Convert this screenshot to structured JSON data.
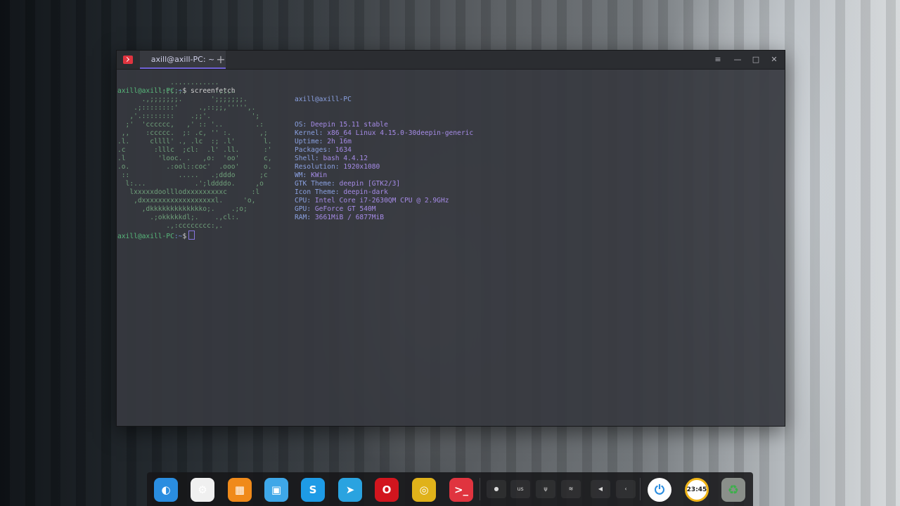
{
  "terminal": {
    "tab_label": "axill@axill-PC: ~",
    "new_tab_symbol": "+",
    "window_buttons": {
      "menu": "≡",
      "minimize": "—",
      "maximize": "□",
      "close": "✕"
    },
    "prompt": {
      "user_host": "axill@axill-PC",
      "path": ":~",
      "symbol": "$"
    },
    "command": "screenfetch",
    "ascii_art": [
      "             ............",
      "         .';;;;;.       .,;,.",
      "      .,;;;;;;;.       ';;;;;;;.",
      "    .;::::::::'     .,::;;,''''',.",
      "   ,'.::::::::    .;;'.          ';",
      "  ;'  'cccccc,   ,' :: '..        .:",
      " ,,    :ccccc.  ;: .c, '' :.       ,;",
      ".l.     cllll' ., .lc  :; .l'       l.",
      ".c       :lllc  ;cl:  .l' .ll.      :'",
      ".l        'looc. .   ,o:  'oo'      c,",
      ".o.         .:ool::coc'  .ooo'      o.",
      " ::            .....   .;dddo      ;c",
      "  l:...            .';lddddo.     ,o",
      "   lxxxxxdoolllodxxxxxxxxxc      :l",
      "    ,dxxxxxxxxxxxxxxxxxxl.     'o,",
      "      ,dkkkkkkkkkkkkko;.    .;o;",
      "        .;okkkkkdl;.    .,cl:.",
      "            .,:cccccccc:,."
    ],
    "info": {
      "host": "axill@axill-PC",
      "rows": [
        {
          "key": "OS:",
          "value": "Deepin 15.11 stable"
        },
        {
          "key": "Kernel:",
          "value": "x86_64 Linux 4.15.0-30deepin-generic"
        },
        {
          "key": "Uptime:",
          "value": "2h 16m"
        },
        {
          "key": "Packages:",
          "value": "1634"
        },
        {
          "key": "Shell:",
          "value": "bash 4.4.12"
        },
        {
          "key": "Resolution:",
          "value": "1920x1080"
        },
        {
          "key": "WM:",
          "value": "KWin"
        },
        {
          "key": "GTK Theme:",
          "value": "deepin [GTK2/3]"
        },
        {
          "key": "Icon Theme:",
          "value": "deepin-dark"
        },
        {
          "key": "CPU:",
          "value": "Intel Core i7-2630QM CPU @ 2.9GHz"
        },
        {
          "key": "GPU:",
          "value": "GeForce GT 540M"
        },
        {
          "key": "RAM:",
          "value": "3661MiB / 6877MiB"
        }
      ]
    }
  },
  "dock": {
    "apps": [
      {
        "name": "deepin-launcher-icon",
        "glyph": "◐",
        "color": "#2a8de0"
      },
      {
        "name": "settings-icon",
        "glyph": "⚙",
        "color": "#f0f0f0"
      },
      {
        "name": "app-store-icon",
        "glyph": "▦",
        "color": "#f08a1a"
      },
      {
        "name": "file-manager-icon",
        "glyph": "▣",
        "color": "#3ea7e8"
      },
      {
        "name": "skype-icon",
        "glyph": "S",
        "color": "#1e9be6"
      },
      {
        "name": "telegram-icon",
        "glyph": "➤",
        "color": "#2aa3e0"
      },
      {
        "name": "opera-icon",
        "glyph": "O",
        "color": "#d2151e"
      },
      {
        "name": "chrome-icon",
        "glyph": "◎",
        "color": "#e0b21a"
      },
      {
        "name": "terminal-icon",
        "glyph": ">_",
        "color": "#e0343f"
      }
    ],
    "tray": {
      "keyboard_layout": "us",
      "system_icons": [
        "notification-dot-icon",
        "usb-icon",
        "wifi-icon",
        "volume-icon",
        "expand-icon"
      ]
    },
    "power_glyph": "⏻",
    "clock_text": "23:45",
    "trash_glyph": "♻"
  }
}
